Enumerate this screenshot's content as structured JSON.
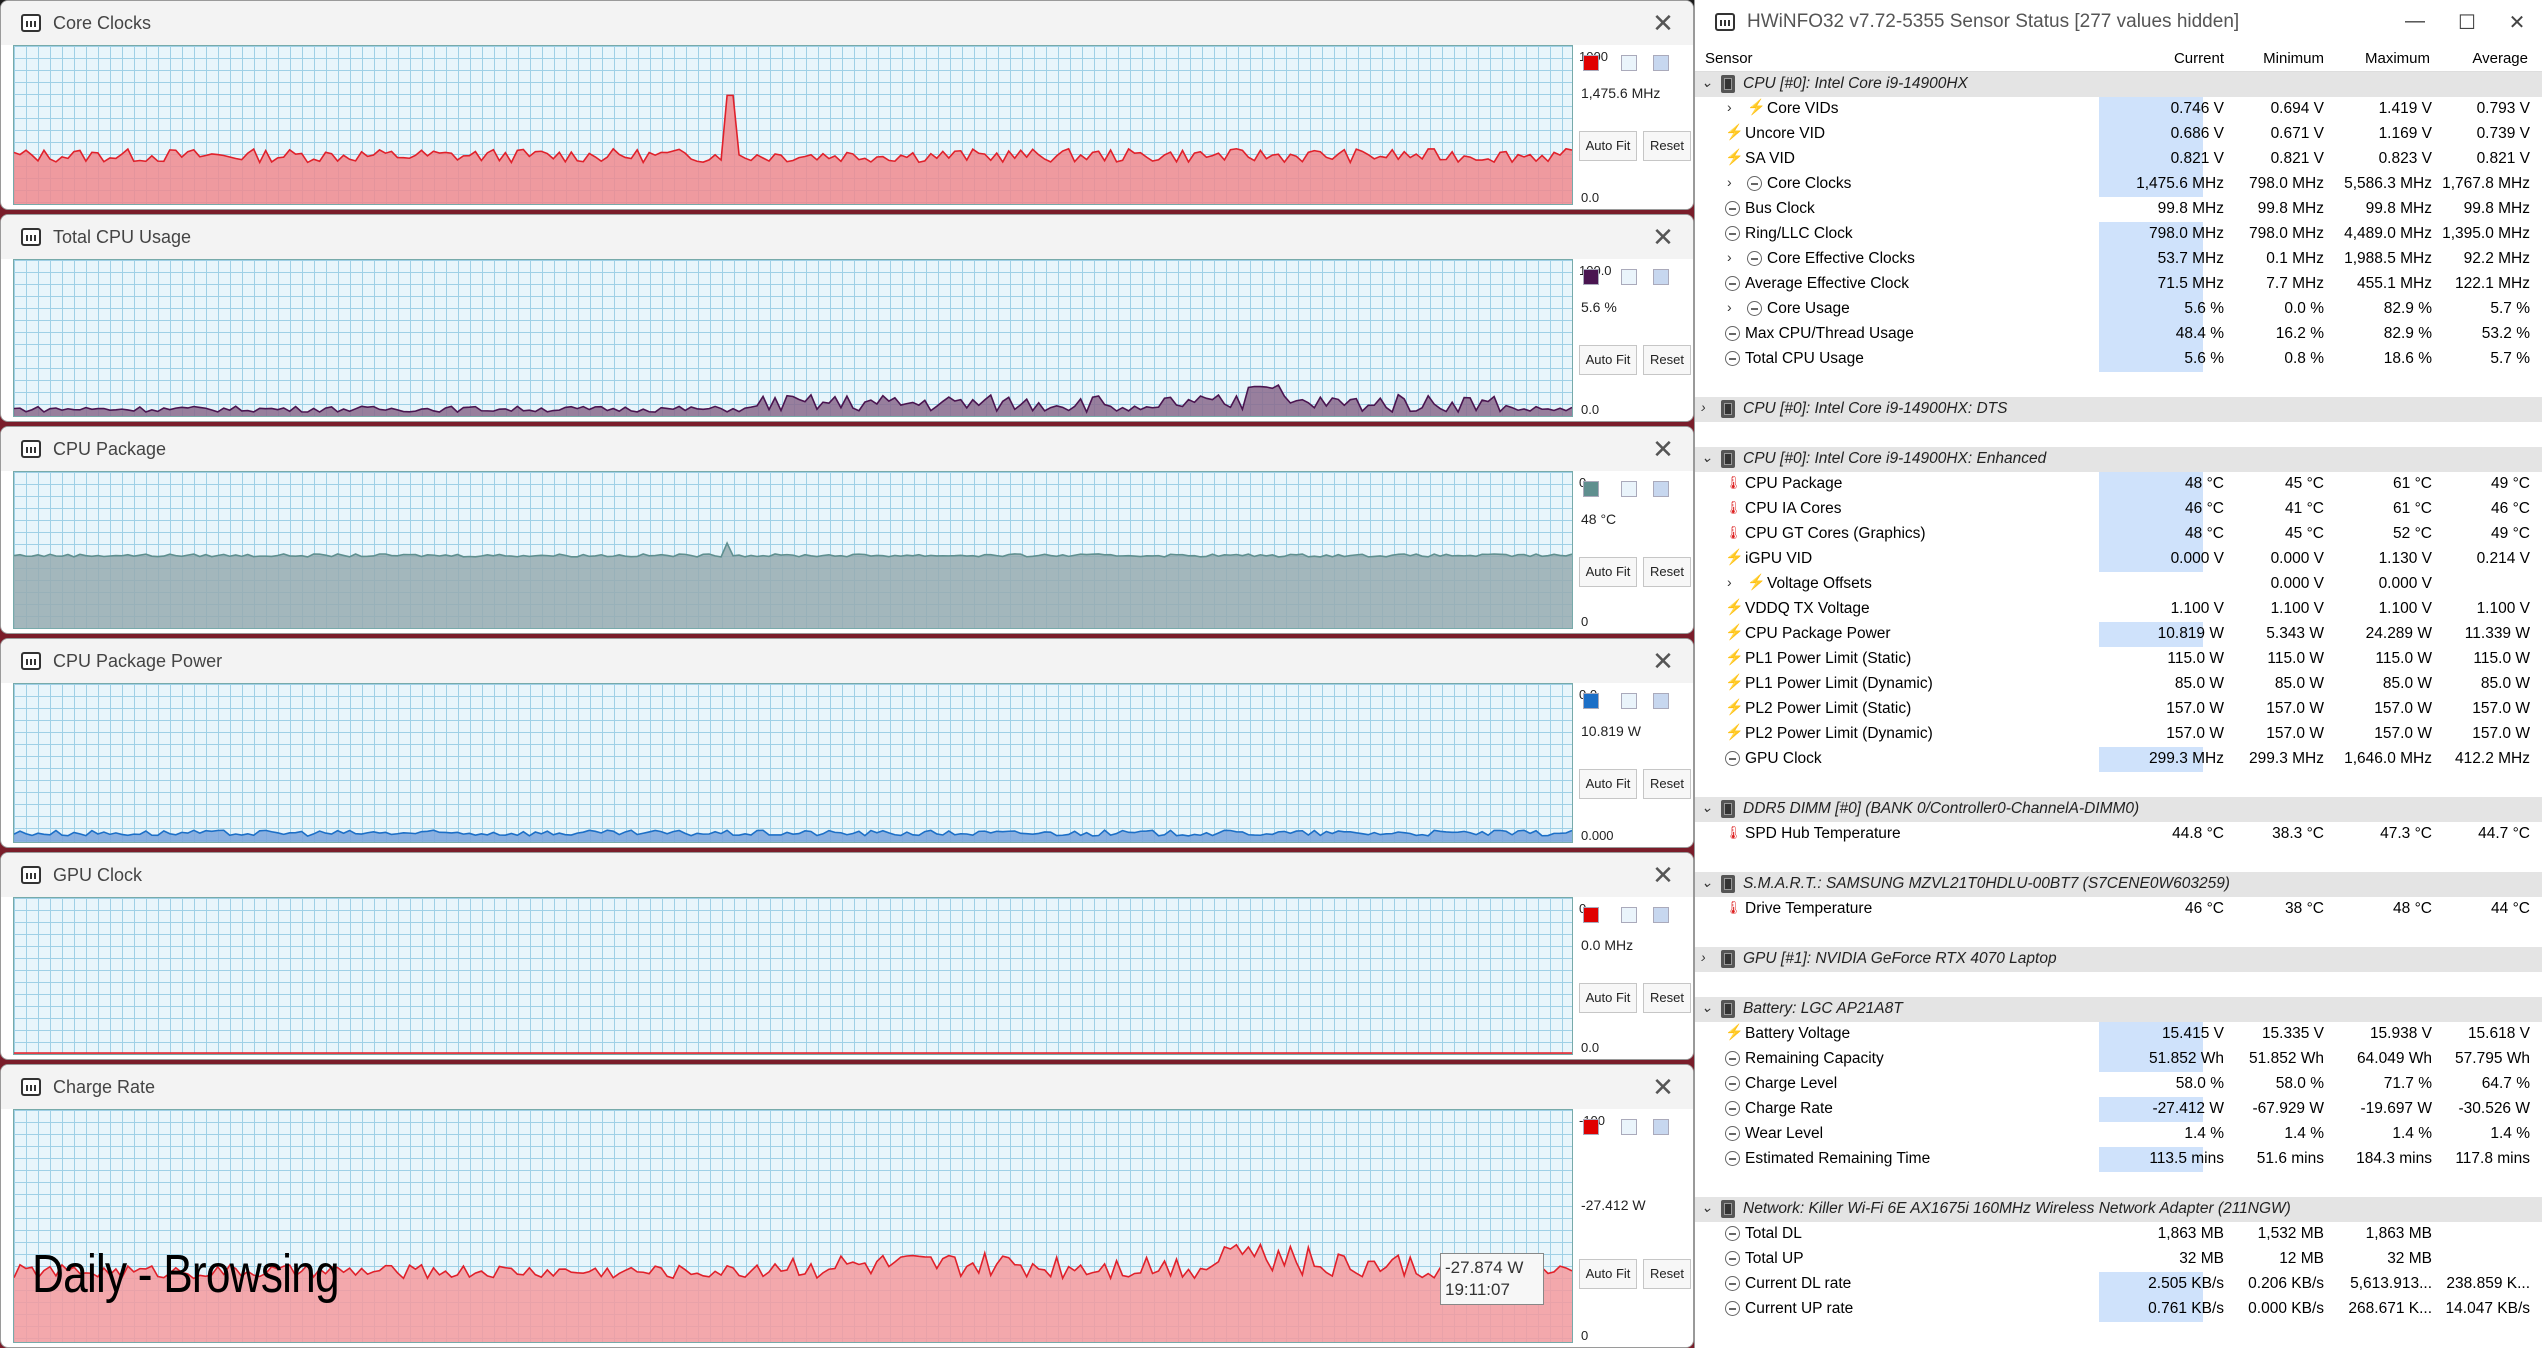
{
  "graph_windows": [
    {
      "title": "Core Clocks",
      "top_label": "1000",
      "current": "1,475.6 MHz",
      "bottom": "0.0",
      "swatch": "#e00000",
      "fill": "#f08a8e",
      "stroke": "#e0202a",
      "autofit": "Auto Fit",
      "reset": "Reset"
    },
    {
      "title": "Total CPU Usage",
      "top_label": "100.0",
      "current": "5.6 %",
      "bottom": "0.0",
      "swatch": "#4a1450",
      "fill": "#8a6a8c",
      "stroke": "#4a1450",
      "autofit": "Auto Fit",
      "reset": "Reset"
    },
    {
      "title": "CPU Package",
      "top_label": "0",
      "current": "48 °C",
      "bottom": "0",
      "swatch": "#5f8f8f",
      "fill": "#97acb0",
      "stroke": "#5f8f8f",
      "autofit": "Auto Fit",
      "reset": "Reset"
    },
    {
      "title": "CPU Package Power",
      "top_label": "0.0",
      "current": "10.819 W",
      "bottom": "0.000",
      "swatch": "#1c6fc7",
      "fill": "#7aa4dc",
      "stroke": "#1c6fc7",
      "autofit": "Auto Fit",
      "reset": "Reset"
    },
    {
      "title": "GPU Clock",
      "top_label": "0",
      "current": "0.0 MHz",
      "bottom": "0.0",
      "swatch": "#e00000",
      "fill": "#f08a8e",
      "stroke": "#e0202a",
      "autofit": "Auto Fit",
      "reset": "Reset"
    },
    {
      "title": "Charge Rate",
      "top_label": "-100",
      "current": "-27.412 W",
      "bottom": "0",
      "swatch": "#e00000",
      "fill": "#f59a9d",
      "stroke": "#e0202a",
      "autofit": "Auto Fit",
      "reset": "Reset"
    }
  ],
  "caption": "Daily - Browsing",
  "tooltip": {
    "value": "-27.874 W",
    "time": "19:11:07"
  },
  "hwinfo": {
    "title": "HWiNFO32 v7.72-5355 Sensor Status [277 values hidden]",
    "columns": [
      "Sensor",
      "Current",
      "Minimum",
      "Maximum",
      "Average"
    ],
    "rows": [
      {
        "t": "grp",
        "toggle": "⌄",
        "name": "CPU [#0]: Intel Core i9-14900HX"
      },
      {
        "t": "s",
        "toggle": "›",
        "icon": "bolt",
        "ind": 2,
        "name": "Core VIDs",
        "cur": "0.746 V",
        "min": "0.694 V",
        "max": "1.419 V",
        "avg": "0.793 V",
        "hl": true
      },
      {
        "t": "s",
        "icon": "bolt",
        "ind": 1,
        "name": "Uncore VID",
        "cur": "0.686 V",
        "min": "0.671 V",
        "max": "1.169 V",
        "avg": "0.739 V",
        "hl": true
      },
      {
        "t": "s",
        "icon": "bolt",
        "ind": 1,
        "name": "SA VID",
        "cur": "0.821 V",
        "min": "0.821 V",
        "max": "0.823 V",
        "avg": "0.821 V",
        "hl": true
      },
      {
        "t": "s",
        "toggle": "›",
        "icon": "clk",
        "ind": 2,
        "name": "Core Clocks",
        "cur": "1,475.6 MHz",
        "min": "798.0 MHz",
        "max": "5,586.3 MHz",
        "avg": "1,767.8 MHz",
        "hl": true
      },
      {
        "t": "s",
        "icon": "clk",
        "ind": 1,
        "name": "Bus Clock",
        "cur": "99.8 MHz",
        "min": "99.8 MHz",
        "max": "99.8 MHz",
        "avg": "99.8 MHz"
      },
      {
        "t": "s",
        "icon": "clk",
        "ind": 1,
        "name": "Ring/LLC Clock",
        "cur": "798.0 MHz",
        "min": "798.0 MHz",
        "max": "4,489.0 MHz",
        "avg": "1,395.0 MHz",
        "hl": true
      },
      {
        "t": "s",
        "toggle": "›",
        "icon": "clk",
        "ind": 2,
        "name": "Core Effective Clocks",
        "cur": "53.7 MHz",
        "min": "0.1 MHz",
        "max": "1,988.5 MHz",
        "avg": "92.2 MHz",
        "hl": true
      },
      {
        "t": "s",
        "icon": "clk",
        "ind": 1,
        "name": "Average Effective Clock",
        "cur": "71.5 MHz",
        "min": "7.7 MHz",
        "max": "455.1 MHz",
        "avg": "122.1 MHz",
        "hl": true
      },
      {
        "t": "s",
        "toggle": "›",
        "icon": "clk",
        "ind": 2,
        "name": "Core Usage",
        "cur": "5.6 %",
        "min": "0.0 %",
        "max": "82.9 %",
        "avg": "5.7 %",
        "hl": true
      },
      {
        "t": "s",
        "icon": "clk",
        "ind": 1,
        "name": "Max CPU/Thread Usage",
        "cur": "48.4 %",
        "min": "16.2 %",
        "max": "82.9 %",
        "avg": "53.2 %",
        "hl": true
      },
      {
        "t": "s",
        "icon": "clk",
        "ind": 1,
        "name": "Total CPU Usage",
        "cur": "5.6 %",
        "min": "0.8 %",
        "max": "18.6 %",
        "avg": "5.7 %",
        "hl": true
      },
      {
        "t": "blank"
      },
      {
        "t": "grp",
        "toggle": "›",
        "name": "CPU [#0]: Intel Core i9-14900HX: DTS"
      },
      {
        "t": "blank"
      },
      {
        "t": "grp",
        "toggle": "⌄",
        "name": "CPU [#0]: Intel Core i9-14900HX: Enhanced"
      },
      {
        "t": "s",
        "icon": "therm",
        "ind": 1,
        "name": "CPU Package",
        "cur": "48 °C",
        "min": "45 °C",
        "max": "61 °C",
        "avg": "49 °C",
        "hl": true
      },
      {
        "t": "s",
        "icon": "therm",
        "ind": 1,
        "name": "CPU IA Cores",
        "cur": "46 °C",
        "min": "41 °C",
        "max": "61 °C",
        "avg": "46 °C",
        "hl": true
      },
      {
        "t": "s",
        "icon": "therm",
        "ind": 1,
        "name": "CPU GT Cores (Graphics)",
        "cur": "48 °C",
        "min": "45 °C",
        "max": "52 °C",
        "avg": "49 °C",
        "hl": true
      },
      {
        "t": "s",
        "icon": "bolt",
        "ind": 1,
        "name": "iGPU VID",
        "cur": "0.000 V",
        "min": "0.000 V",
        "max": "1.130 V",
        "avg": "0.214 V",
        "hl": true
      },
      {
        "t": "s",
        "toggle": "›",
        "icon": "bolt",
        "ind": 2,
        "name": "Voltage Offsets",
        "cur": "",
        "min": "0.000 V",
        "max": "0.000 V",
        "avg": ""
      },
      {
        "t": "s",
        "icon": "bolt",
        "ind": 1,
        "name": "VDDQ TX Voltage",
        "cur": "1.100 V",
        "min": "1.100 V",
        "max": "1.100 V",
        "avg": "1.100 V"
      },
      {
        "t": "s",
        "icon": "bolt",
        "ind": 1,
        "name": "CPU Package Power",
        "cur": "10.819 W",
        "min": "5.343 W",
        "max": "24.289 W",
        "avg": "11.339 W",
        "hl": true
      },
      {
        "t": "s",
        "icon": "bolt",
        "ind": 1,
        "name": "PL1 Power Limit (Static)",
        "cur": "115.0 W",
        "min": "115.0 W",
        "max": "115.0 W",
        "avg": "115.0 W"
      },
      {
        "t": "s",
        "icon": "bolt",
        "ind": 1,
        "name": "PL1 Power Limit (Dynamic)",
        "cur": "85.0 W",
        "min": "85.0 W",
        "max": "85.0 W",
        "avg": "85.0 W"
      },
      {
        "t": "s",
        "icon": "bolt",
        "ind": 1,
        "name": "PL2 Power Limit (Static)",
        "cur": "157.0 W",
        "min": "157.0 W",
        "max": "157.0 W",
        "avg": "157.0 W"
      },
      {
        "t": "s",
        "icon": "bolt",
        "ind": 1,
        "name": "PL2 Power Limit (Dynamic)",
        "cur": "157.0 W",
        "min": "157.0 W",
        "max": "157.0 W",
        "avg": "157.0 W"
      },
      {
        "t": "s",
        "icon": "clk",
        "ind": 1,
        "name": "GPU Clock",
        "cur": "299.3 MHz",
        "min": "299.3 MHz",
        "max": "1,646.0 MHz",
        "avg": "412.2 MHz",
        "hl": true
      },
      {
        "t": "blank"
      },
      {
        "t": "grp",
        "toggle": "⌄",
        "name": "DDR5 DIMM [#0] (BANK 0/Controller0-ChannelA-DIMM0)"
      },
      {
        "t": "s",
        "icon": "therm",
        "ind": 1,
        "name": "SPD Hub Temperature",
        "cur": "44.8 °C",
        "min": "38.3 °C",
        "max": "47.3 °C",
        "avg": "44.7 °C"
      },
      {
        "t": "blank"
      },
      {
        "t": "grp",
        "toggle": "⌄",
        "name": "S.M.A.R.T.: SAMSUNG MZVL21T0HDLU-00BT7 (S7CENE0W603259)"
      },
      {
        "t": "s",
        "icon": "therm",
        "ind": 1,
        "name": "Drive Temperature",
        "cur": "46 °C",
        "min": "38 °C",
        "max": "48 °C",
        "avg": "44 °C"
      },
      {
        "t": "blank"
      },
      {
        "t": "grp",
        "toggle": "›",
        "name": "GPU [#1]: NVIDIA GeForce RTX 4070 Laptop"
      },
      {
        "t": "blank"
      },
      {
        "t": "grp",
        "toggle": "⌄",
        "name": "Battery: LGC  AP21A8T"
      },
      {
        "t": "s",
        "icon": "bolt",
        "ind": 1,
        "name": "Battery Voltage",
        "cur": "15.415 V",
        "min": "15.335 V",
        "max": "15.938 V",
        "avg": "15.618 V",
        "hl": true
      },
      {
        "t": "s",
        "icon": "clk",
        "ind": 1,
        "name": "Remaining Capacity",
        "cur": "51.852 Wh",
        "min": "51.852 Wh",
        "max": "64.049 Wh",
        "avg": "57.795 Wh",
        "hl": true
      },
      {
        "t": "s",
        "icon": "clk",
        "ind": 1,
        "name": "Charge Level",
        "cur": "58.0 %",
        "min": "58.0 %",
        "max": "71.7 %",
        "avg": "64.7 %"
      },
      {
        "t": "s",
        "icon": "clk",
        "ind": 1,
        "name": "Charge Rate",
        "cur": "-27.412 W",
        "min": "-67.929 W",
        "max": "-19.697 W",
        "avg": "-30.526 W",
        "hl": true
      },
      {
        "t": "s",
        "icon": "clk",
        "ind": 1,
        "name": "Wear Level",
        "cur": "1.4 %",
        "min": "1.4 %",
        "max": "1.4 %",
        "avg": "1.4 %"
      },
      {
        "t": "s",
        "icon": "clk",
        "ind": 1,
        "name": "Estimated Remaining Time",
        "cur": "113.5 mins",
        "min": "51.6 mins",
        "max": "184.3 mins",
        "avg": "117.8 mins",
        "hl": true
      },
      {
        "t": "blank"
      },
      {
        "t": "grp",
        "toggle": "⌄",
        "name": "Network: Killer Wi-Fi 6E AX1675i 160MHz Wireless Network Adapter (211NGW)"
      },
      {
        "t": "s",
        "icon": "clk",
        "ind": 1,
        "name": "Total DL",
        "cur": "1,863 MB",
        "min": "1,532 MB",
        "max": "1,863 MB",
        "avg": ""
      },
      {
        "t": "s",
        "icon": "clk",
        "ind": 1,
        "name": "Total UP",
        "cur": "32 MB",
        "min": "12 MB",
        "max": "32 MB",
        "avg": ""
      },
      {
        "t": "s",
        "icon": "clk",
        "ind": 1,
        "name": "Current DL rate",
        "cur": "2.505 KB/s",
        "min": "0.206 KB/s",
        "max": "5,613.913...",
        "avg": "238.859 K...",
        "hl": true
      },
      {
        "t": "s",
        "icon": "clk",
        "ind": 1,
        "name": "Current UP rate",
        "cur": "0.761 KB/s",
        "min": "0.000 KB/s",
        "max": "268.671 K...",
        "avg": "14.047 KB/s",
        "hl": true
      }
    ]
  }
}
